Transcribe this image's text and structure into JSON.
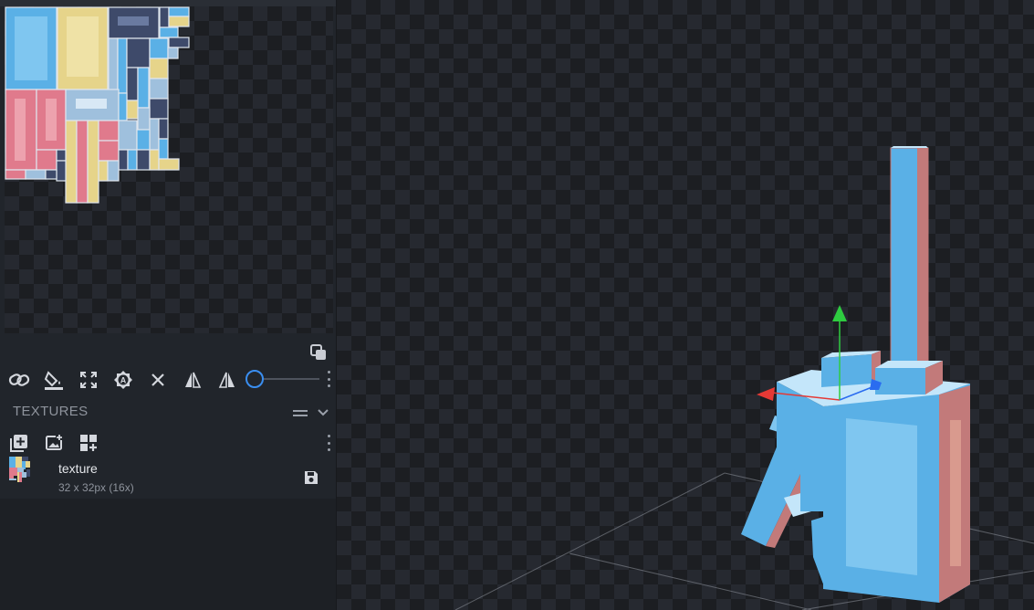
{
  "textures_panel": {
    "title": "TEXTURES"
  },
  "texture": {
    "name": "texture",
    "meta": "32 x 32px (16x)"
  },
  "colors": {
    "accent": "#3a8ef0",
    "cube_blue": "#5ab0e6",
    "cube_top": "#c4e6fa",
    "cube_side": "#c27a7a",
    "uv_yellow": "#e6d48a",
    "uv_pink": "#e07a8c",
    "uv_navy": "#3e4a6a",
    "axis_x": "#e53935",
    "axis_y": "#2ecc40",
    "axis_z": "#2a6cf0"
  },
  "icons": {
    "uv_toolbar": [
      "link-icon",
      "paint-bucket-icon",
      "maximize-icon",
      "auto-uv-icon",
      "close-icon",
      "mirror-x-icon",
      "mirror-y-icon"
    ],
    "textures_toolbar": [
      "add-texture-icon",
      "import-texture-icon",
      "texture-generator-icon"
    ]
  }
}
